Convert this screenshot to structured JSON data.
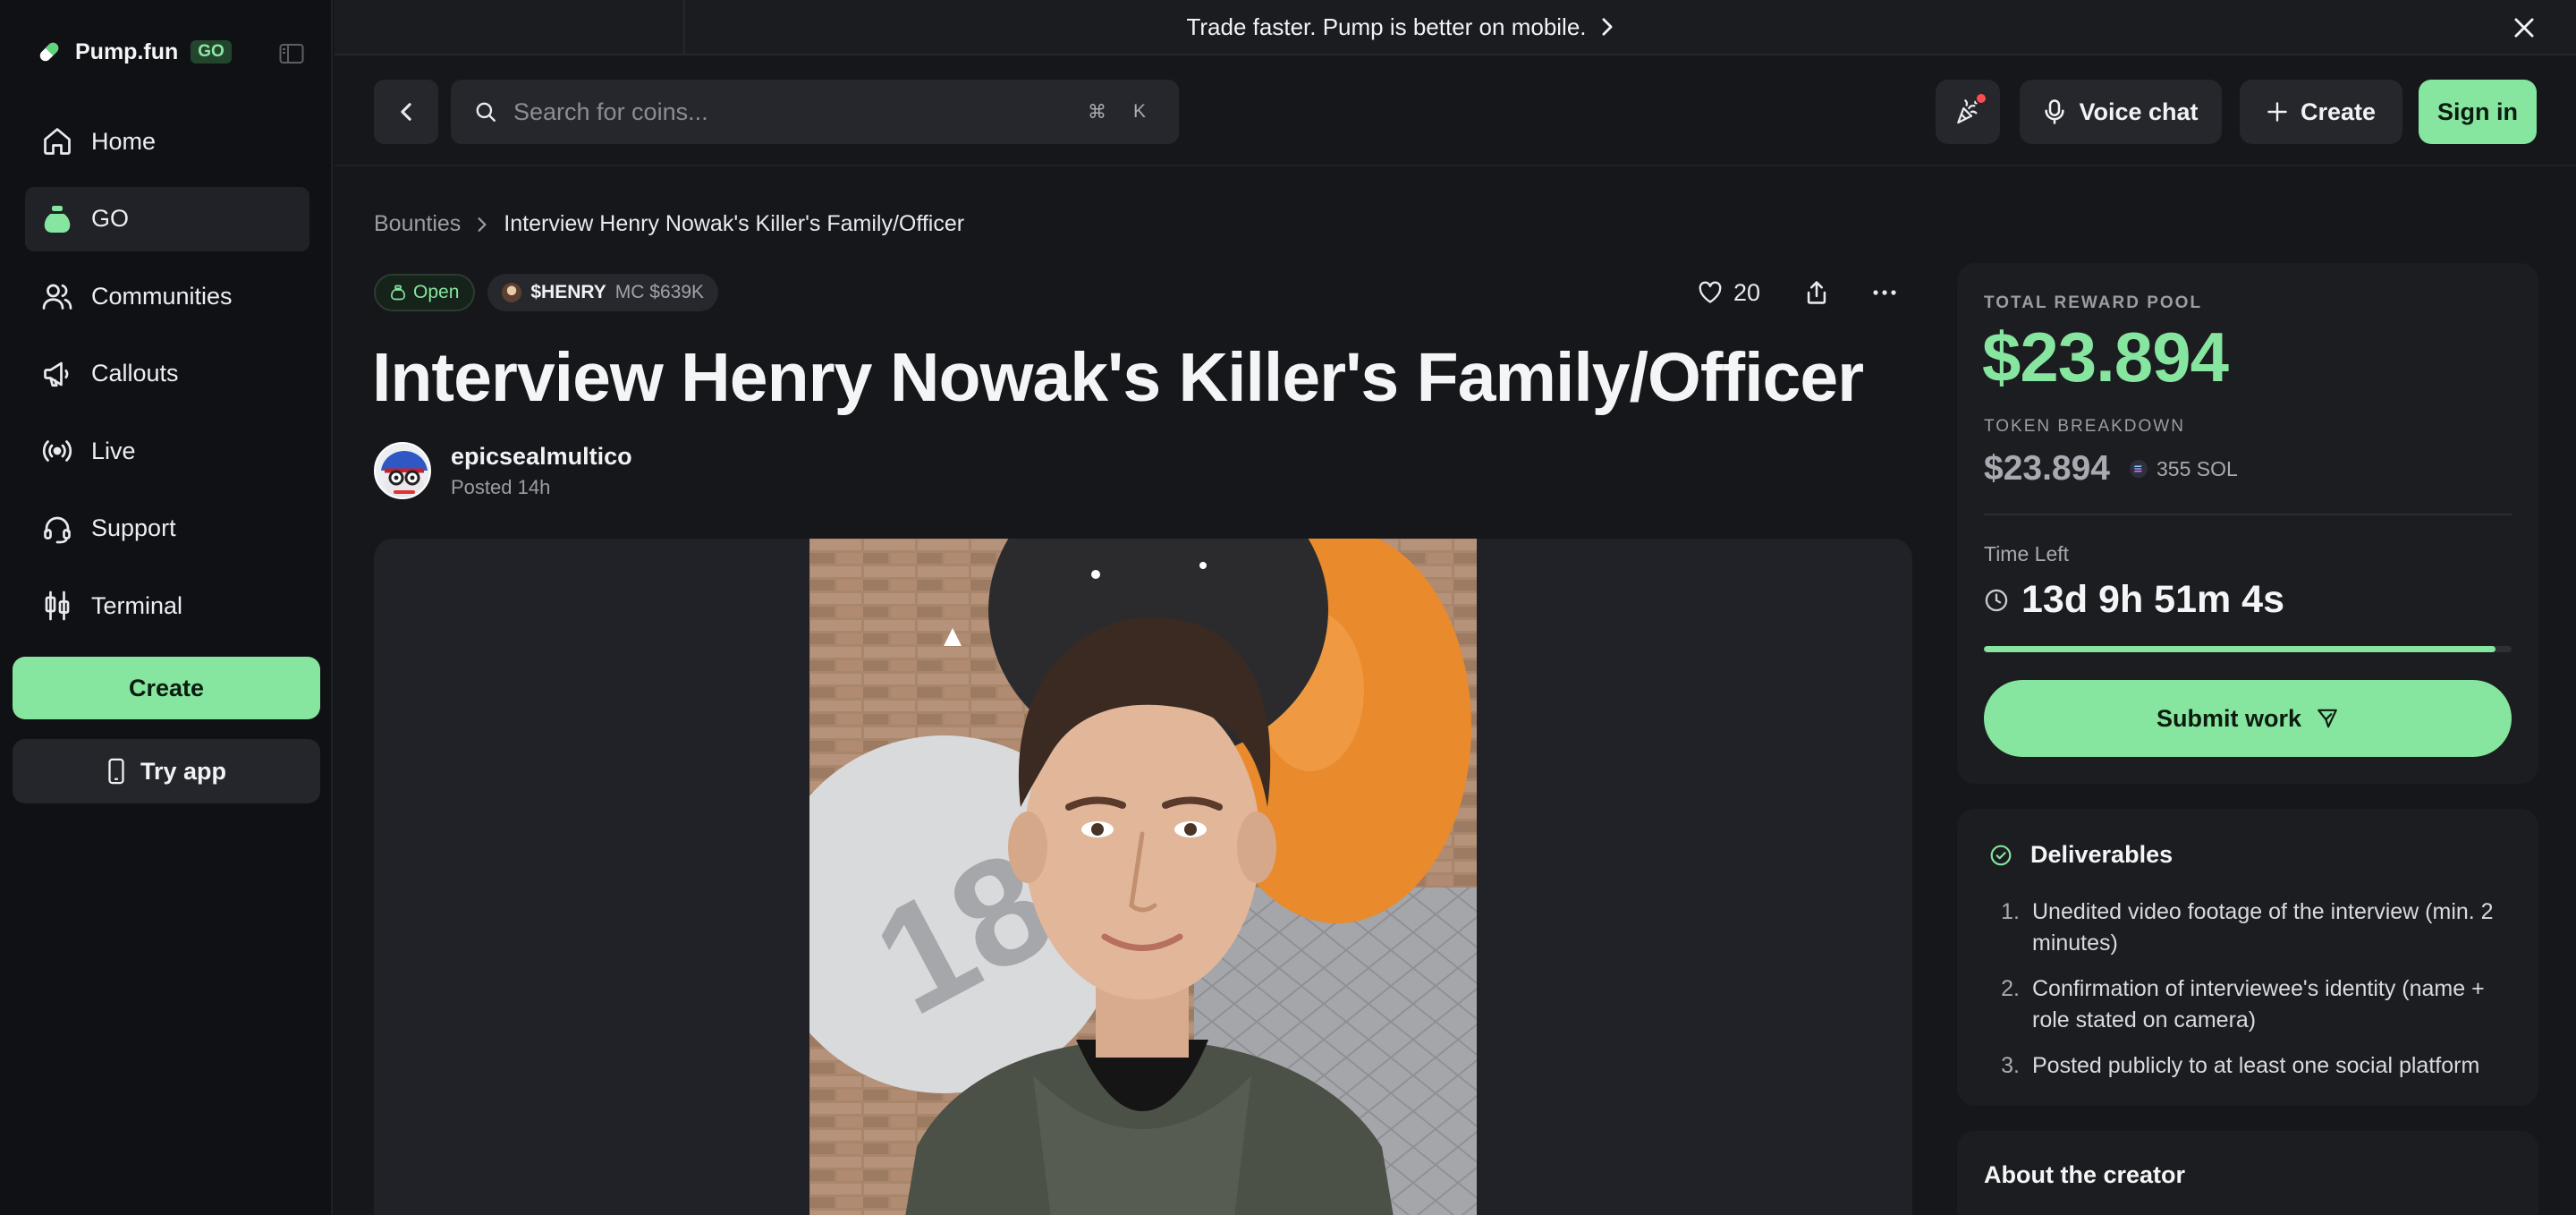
{
  "sidebar": {
    "brand_name": "Pump.fun",
    "brand_badge": "GO",
    "items": [
      {
        "label": "Home",
        "icon": "home-icon"
      },
      {
        "label": "GO",
        "icon": "money-bag-icon"
      },
      {
        "label": "Communities",
        "icon": "users-icon"
      },
      {
        "label": "Callouts",
        "icon": "megaphone-icon"
      },
      {
        "label": "Live",
        "icon": "broadcast-icon"
      },
      {
        "label": "Support",
        "icon": "headset-icon"
      },
      {
        "label": "Terminal",
        "icon": "candlestick-icon"
      }
    ],
    "active_item": "GO",
    "create_label": "Create",
    "try_app_label": "Try app"
  },
  "banner": {
    "text": "Trade faster. Pump is better on mobile."
  },
  "header": {
    "search_placeholder": "Search for coins...",
    "shortcut_mod": "⌘",
    "shortcut_key": "K",
    "voice_chat_label": "Voice chat",
    "create_label": "Create",
    "sign_in_label": "Sign in"
  },
  "breadcrumb": {
    "root": "Bounties",
    "current": "Interview Henry Nowak's Killer's Family/Officer"
  },
  "bounty": {
    "status": "Open",
    "ticker": "$HENRY",
    "market_cap": "MC $639K",
    "likes": "20",
    "title": "Interview Henry Nowak's Killer's Family/Officer",
    "author": "epicsealmultico",
    "posted": "Posted 14h"
  },
  "reward": {
    "pool_label": "TOTAL REWARD POOL",
    "pool_value": "$23.894",
    "breakdown_label": "TOKEN BREAKDOWN",
    "breakdown_usd": "$23.894",
    "breakdown_sol": "355 SOL",
    "time_left_label": "Time Left",
    "time_left": "13d 9h 51m 4s",
    "time_progress": 0.97,
    "submit_label": "Submit work"
  },
  "deliverables": {
    "title": "Deliverables",
    "items": [
      {
        "num": "1.",
        "text": "Unedited video footage of the interview (min. 2 minutes)"
      },
      {
        "num": "2.",
        "text": "Confirmation of interviewee's identity (name + role stated on camera)"
      },
      {
        "num": "3.",
        "text": "Posted publicly to at least one social platform"
      }
    ]
  },
  "about": {
    "title": "About the creator"
  },
  "colors": {
    "accent": "#86e59e",
    "background": "#16171b",
    "sidebar": "#101114",
    "surface": "#1c1d21",
    "notification": "#ff4d4f"
  }
}
